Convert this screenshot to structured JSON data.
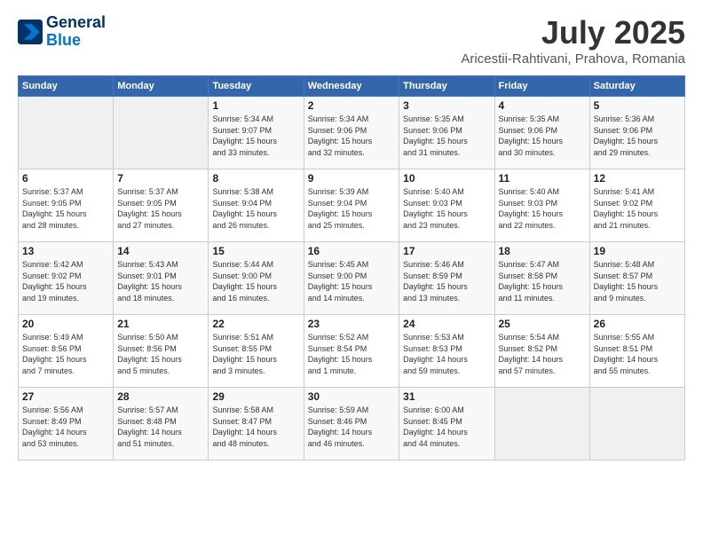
{
  "header": {
    "logo_line1": "General",
    "logo_line2": "Blue",
    "month_year": "July 2025",
    "location": "Aricestii-Rahtivani, Prahova, Romania"
  },
  "weekdays": [
    "Sunday",
    "Monday",
    "Tuesday",
    "Wednesday",
    "Thursday",
    "Friday",
    "Saturday"
  ],
  "weeks": [
    [
      {
        "day": "",
        "info": ""
      },
      {
        "day": "",
        "info": ""
      },
      {
        "day": "1",
        "info": "Sunrise: 5:34 AM\nSunset: 9:07 PM\nDaylight: 15 hours\nand 33 minutes."
      },
      {
        "day": "2",
        "info": "Sunrise: 5:34 AM\nSunset: 9:06 PM\nDaylight: 15 hours\nand 32 minutes."
      },
      {
        "day": "3",
        "info": "Sunrise: 5:35 AM\nSunset: 9:06 PM\nDaylight: 15 hours\nand 31 minutes."
      },
      {
        "day": "4",
        "info": "Sunrise: 5:35 AM\nSunset: 9:06 PM\nDaylight: 15 hours\nand 30 minutes."
      },
      {
        "day": "5",
        "info": "Sunrise: 5:36 AM\nSunset: 9:06 PM\nDaylight: 15 hours\nand 29 minutes."
      }
    ],
    [
      {
        "day": "6",
        "info": "Sunrise: 5:37 AM\nSunset: 9:05 PM\nDaylight: 15 hours\nand 28 minutes."
      },
      {
        "day": "7",
        "info": "Sunrise: 5:37 AM\nSunset: 9:05 PM\nDaylight: 15 hours\nand 27 minutes."
      },
      {
        "day": "8",
        "info": "Sunrise: 5:38 AM\nSunset: 9:04 PM\nDaylight: 15 hours\nand 26 minutes."
      },
      {
        "day": "9",
        "info": "Sunrise: 5:39 AM\nSunset: 9:04 PM\nDaylight: 15 hours\nand 25 minutes."
      },
      {
        "day": "10",
        "info": "Sunrise: 5:40 AM\nSunset: 9:03 PM\nDaylight: 15 hours\nand 23 minutes."
      },
      {
        "day": "11",
        "info": "Sunrise: 5:40 AM\nSunset: 9:03 PM\nDaylight: 15 hours\nand 22 minutes."
      },
      {
        "day": "12",
        "info": "Sunrise: 5:41 AM\nSunset: 9:02 PM\nDaylight: 15 hours\nand 21 minutes."
      }
    ],
    [
      {
        "day": "13",
        "info": "Sunrise: 5:42 AM\nSunset: 9:02 PM\nDaylight: 15 hours\nand 19 minutes."
      },
      {
        "day": "14",
        "info": "Sunrise: 5:43 AM\nSunset: 9:01 PM\nDaylight: 15 hours\nand 18 minutes."
      },
      {
        "day": "15",
        "info": "Sunrise: 5:44 AM\nSunset: 9:00 PM\nDaylight: 15 hours\nand 16 minutes."
      },
      {
        "day": "16",
        "info": "Sunrise: 5:45 AM\nSunset: 9:00 PM\nDaylight: 15 hours\nand 14 minutes."
      },
      {
        "day": "17",
        "info": "Sunrise: 5:46 AM\nSunset: 8:59 PM\nDaylight: 15 hours\nand 13 minutes."
      },
      {
        "day": "18",
        "info": "Sunrise: 5:47 AM\nSunset: 8:58 PM\nDaylight: 15 hours\nand 11 minutes."
      },
      {
        "day": "19",
        "info": "Sunrise: 5:48 AM\nSunset: 8:57 PM\nDaylight: 15 hours\nand 9 minutes."
      }
    ],
    [
      {
        "day": "20",
        "info": "Sunrise: 5:49 AM\nSunset: 8:56 PM\nDaylight: 15 hours\nand 7 minutes."
      },
      {
        "day": "21",
        "info": "Sunrise: 5:50 AM\nSunset: 8:56 PM\nDaylight: 15 hours\nand 5 minutes."
      },
      {
        "day": "22",
        "info": "Sunrise: 5:51 AM\nSunset: 8:55 PM\nDaylight: 15 hours\nand 3 minutes."
      },
      {
        "day": "23",
        "info": "Sunrise: 5:52 AM\nSunset: 8:54 PM\nDaylight: 15 hours\nand 1 minute."
      },
      {
        "day": "24",
        "info": "Sunrise: 5:53 AM\nSunset: 8:53 PM\nDaylight: 14 hours\nand 59 minutes."
      },
      {
        "day": "25",
        "info": "Sunrise: 5:54 AM\nSunset: 8:52 PM\nDaylight: 14 hours\nand 57 minutes."
      },
      {
        "day": "26",
        "info": "Sunrise: 5:55 AM\nSunset: 8:51 PM\nDaylight: 14 hours\nand 55 minutes."
      }
    ],
    [
      {
        "day": "27",
        "info": "Sunrise: 5:56 AM\nSunset: 8:49 PM\nDaylight: 14 hours\nand 53 minutes."
      },
      {
        "day": "28",
        "info": "Sunrise: 5:57 AM\nSunset: 8:48 PM\nDaylight: 14 hours\nand 51 minutes."
      },
      {
        "day": "29",
        "info": "Sunrise: 5:58 AM\nSunset: 8:47 PM\nDaylight: 14 hours\nand 48 minutes."
      },
      {
        "day": "30",
        "info": "Sunrise: 5:59 AM\nSunset: 8:46 PM\nDaylight: 14 hours\nand 46 minutes."
      },
      {
        "day": "31",
        "info": "Sunrise: 6:00 AM\nSunset: 8:45 PM\nDaylight: 14 hours\nand 44 minutes."
      },
      {
        "day": "",
        "info": ""
      },
      {
        "day": "",
        "info": ""
      }
    ]
  ]
}
